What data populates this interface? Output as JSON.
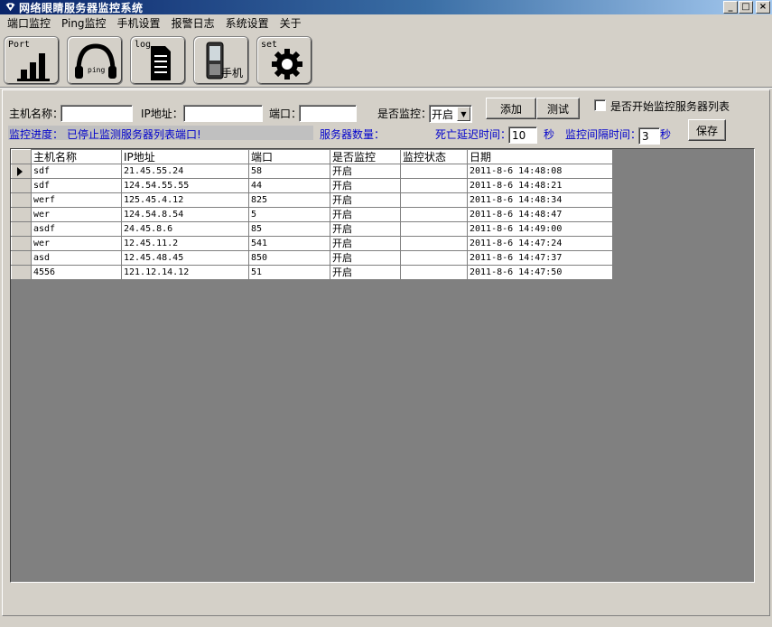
{
  "window": {
    "title": "网络眼睛服务器监控系统",
    "controls": [
      "_",
      "□",
      "×"
    ]
  },
  "menu": [
    "端口监控",
    "Ping监控",
    "手机设置",
    "报警日志",
    "系统设置",
    "关于"
  ],
  "toolbar": {
    "port_tag": "Port",
    "ping_tag": "ping",
    "log_tag": "log",
    "phone_tag": "手机",
    "set_tag": "set"
  },
  "form": {
    "host_label": "主机名称：",
    "host_value": "",
    "ip_label": "IP地址：",
    "ip_value": "",
    "port_label": "端口：",
    "port_value": "",
    "monitor_label": "是否监控：",
    "monitor_value": "开启",
    "add_button": "添加",
    "test_button": "测试",
    "start_checkbox_label": "是否开始监控服务器列表",
    "progress_label": "监控进度：",
    "progress_text": "已停止监测服务器列表端口!",
    "server_count_label": "服务器数量：",
    "timeout_label": "死亡延迟时间：",
    "timeout_value": "10",
    "timeout_unit": "秒",
    "interval_label": "监控间隔时间：",
    "interval_value": "3",
    "interval_unit": "秒",
    "save_button": "保存"
  },
  "table": {
    "columns": [
      "主机名称",
      "IP地址",
      "端口",
      "是否监控",
      "监控状态",
      "日期"
    ],
    "rows": [
      [
        "sdf",
        "21.45.55.24",
        "58",
        "开启",
        "",
        "2011-8-6 14:48:08"
      ],
      [
        "sdf",
        "124.54.55.55",
        "44",
        "开启",
        "",
        "2011-8-6 14:48:21"
      ],
      [
        "werf",
        "125.45.4.12",
        "825",
        "开启",
        "",
        "2011-8-6 14:48:34"
      ],
      [
        "wer",
        "124.54.8.54",
        "5",
        "开启",
        "",
        "2011-8-6 14:48:47"
      ],
      [
        "asdf",
        "24.45.8.6",
        "85",
        "开启",
        "",
        "2011-8-6 14:49:00"
      ],
      [
        "wer",
        "12.45.11.2",
        "541",
        "开启",
        "",
        "2011-8-6 14:47:24"
      ],
      [
        "asd",
        "12.45.48.45",
        "850",
        "开启",
        "",
        "2011-8-6 14:47:37"
      ],
      [
        "4556",
        "121.12.14.12",
        "51",
        "开启",
        "",
        "2011-8-6 14:47:50"
      ]
    ]
  }
}
